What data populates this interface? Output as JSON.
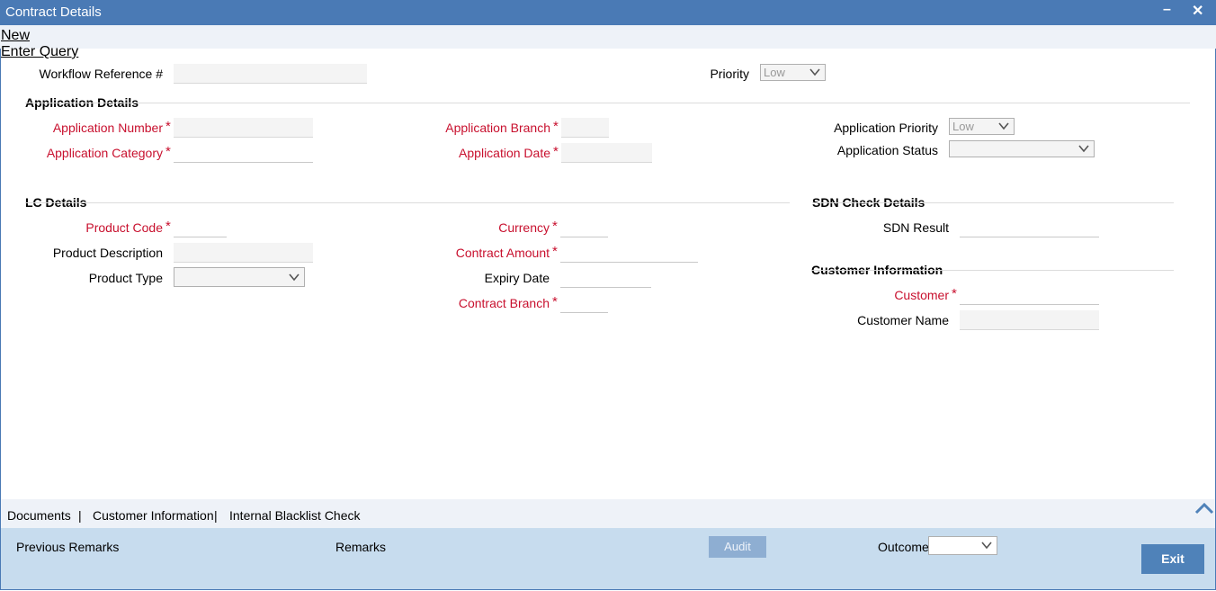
{
  "window": {
    "title": "Contract Details",
    "minimize_glyph": "–",
    "close_glyph": "✕"
  },
  "menu": {
    "new": "New",
    "enter_query": "Enter Query"
  },
  "header": {
    "workflow_ref_label": "Workflow Reference #",
    "priority_label": "Priority",
    "priority_value": "Low"
  },
  "application": {
    "section_title": "Application Details",
    "number_label": "Application Number",
    "category_label": "Application Category",
    "branch_label": "Application Branch",
    "date_label": "Application Date",
    "priority_label": "Application Priority",
    "priority_value": "Low",
    "status_label": "Application Status",
    "status_value": ""
  },
  "lc": {
    "section_title": "LC Details",
    "product_code_label": "Product Code",
    "product_desc_label": "Product Description",
    "product_type_label": "Product Type",
    "currency_label": "Currency",
    "contract_amount_label": "Contract Amount",
    "expiry_date_label": "Expiry Date",
    "contract_branch_label": "Contract Branch"
  },
  "sdn": {
    "section_title": "SDN Check Details",
    "result_label": "SDN Result"
  },
  "customer": {
    "section_title": "Customer Information",
    "customer_label": "Customer",
    "customer_name_label": "Customer Name"
  },
  "required_mark": "*",
  "tabs": {
    "items": [
      "Documents",
      "Customer Information",
      "Internal Blacklist Check"
    ],
    "separator": "|"
  },
  "footer": {
    "previous_remarks": "Previous Remarks",
    "remarks": "Remarks",
    "audit": "Audit",
    "outcome_label": "Outcome",
    "outcome_value": "",
    "exit": "Exit"
  },
  "colors": {
    "titlebar": "#4a7ab5",
    "required": "#c8102e",
    "footer": "#c7dcee",
    "exit_button": "#4f82b9"
  },
  "icons": {
    "scroll_up": "chevron-up-icon",
    "dropdown": "chevron-down-icon"
  }
}
